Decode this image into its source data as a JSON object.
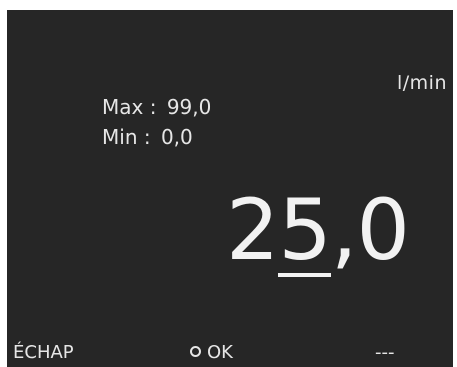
{
  "display": {
    "unit": "l/min",
    "max_label": "Max :",
    "max_value": "99,0",
    "min_label": "Min :",
    "min_value": "0,0",
    "value_prefix": "2",
    "value_edit_digit": "5",
    "value_suffix": ",0"
  },
  "softkeys": {
    "left_label": "ÉCHAP",
    "middle_label": "OK",
    "middle_icon": "circle-icon",
    "right_label": "---"
  }
}
